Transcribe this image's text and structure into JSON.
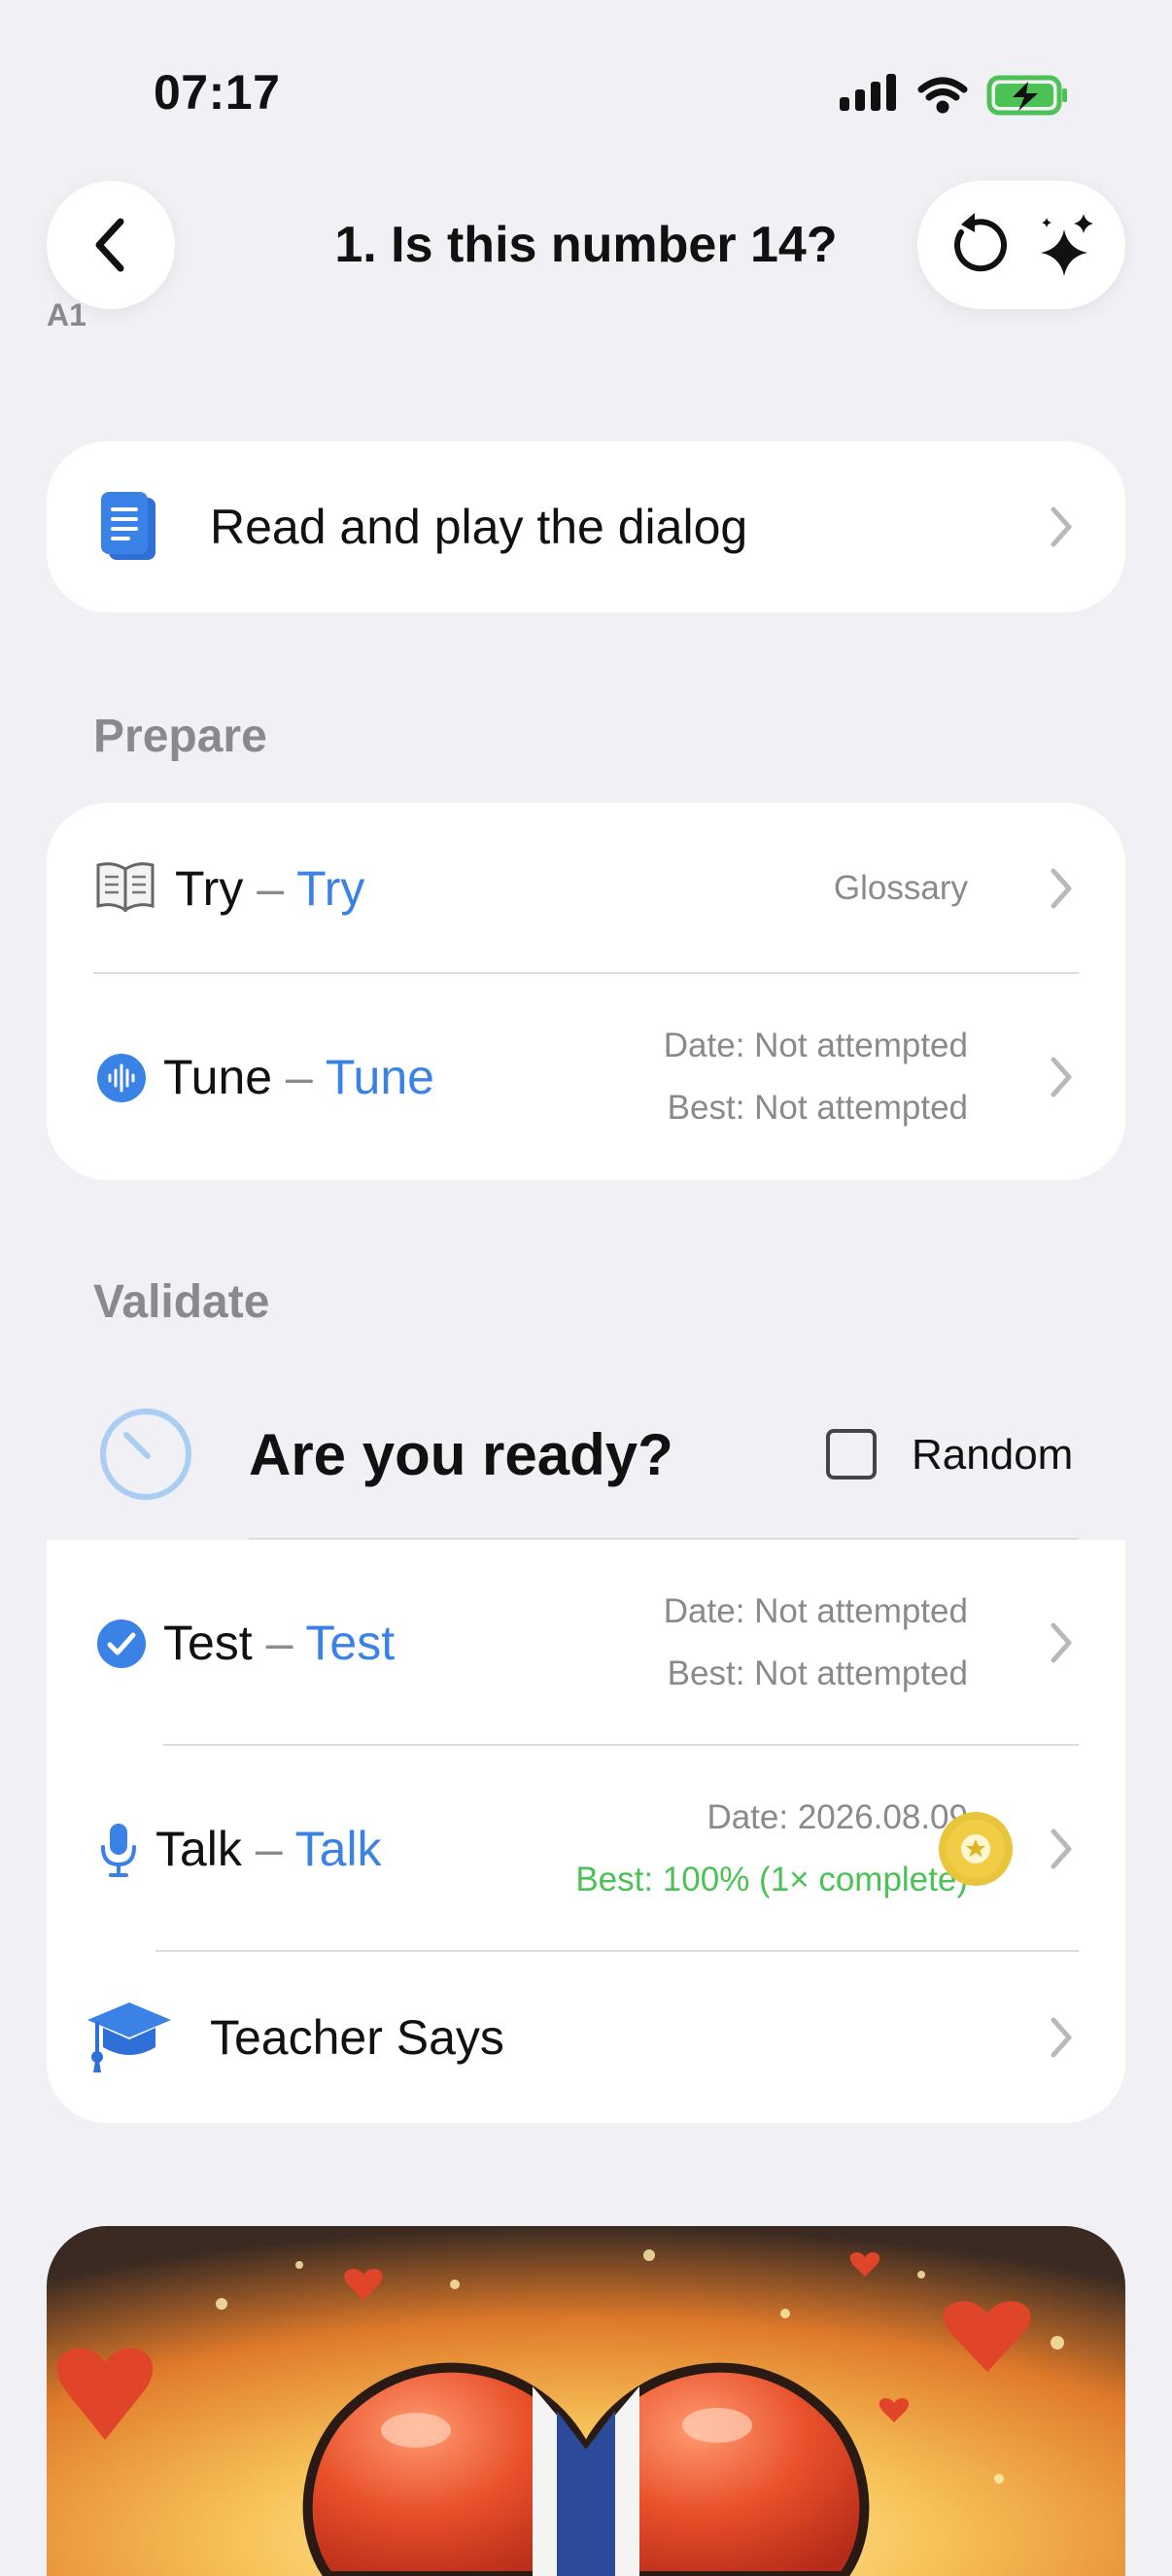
{
  "status": {
    "time": "07:17"
  },
  "header": {
    "title": "1. Is this number 14?",
    "level": "A1"
  },
  "dialog_row": {
    "label": "Read and play the dialog"
  },
  "prepare": {
    "heading": "Prepare",
    "items": [
      {
        "native": "Try",
        "dash": "–",
        "english": "Try",
        "meta1": "Glossary"
      },
      {
        "native": "Tune",
        "dash": "–",
        "english": "Tune",
        "meta1": "Date: Not attempted",
        "meta2": "Best: Not attempted"
      }
    ]
  },
  "validate": {
    "heading": "Validate",
    "ready_title": "Are you ready?",
    "random_label": "Random",
    "random_checked": false,
    "items": [
      {
        "native": "Test",
        "dash": "–",
        "english": "Test",
        "meta1": "Date: Not attempted",
        "meta2": "Best: Not attempted"
      },
      {
        "native": "Talk",
        "dash": "–",
        "english": "Talk",
        "meta1": "Date: 2026.08.09",
        "meta2": "Best: 100% (1× complete)"
      },
      {
        "label": "Teacher Says"
      }
    ]
  },
  "colors": {
    "background": "#f0f0f5",
    "accent_blue": "#3b82e6",
    "success_green": "#4cc155",
    "secondary_text": "#8a8a8e",
    "medal_gold": "#e8c53a"
  },
  "icons": {
    "back": "chevron-left-icon",
    "restart": "restart-icon",
    "ai": "sparkles-icon",
    "dialog": "document-icon",
    "glossary": "open-book-icon",
    "tune": "waveform-icon",
    "ready": "stopwatch-icon",
    "test": "checkmark-circle-icon",
    "talk": "microphone-icon",
    "teacher": "graduation-cap-icon",
    "medal": "star-medal-icon"
  }
}
